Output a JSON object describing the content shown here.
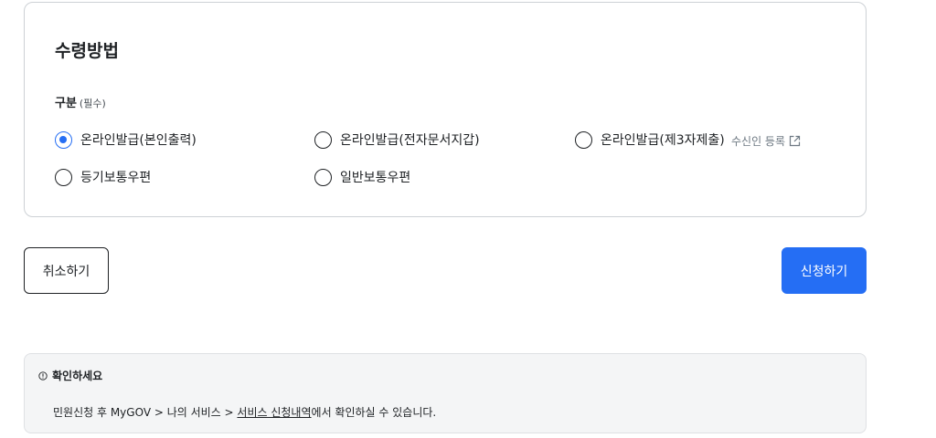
{
  "receipt": {
    "title": "수령방법",
    "field_label": "구분",
    "field_required": "(필수)",
    "options": [
      {
        "label": "온라인발급(본인출력)",
        "checked": true
      },
      {
        "label": "온라인발급(전자문서지갑)",
        "checked": false
      },
      {
        "label": "온라인발급(제3자제출)",
        "checked": false
      },
      {
        "label": "등기보통우편",
        "checked": false
      },
      {
        "label": "일반보통우편",
        "checked": false
      }
    ],
    "recipient_link": "수신인 등록",
    "recipient_link_icon": "external-link-icon"
  },
  "actions": {
    "cancel_label": "취소하기",
    "submit_label": "신청하기"
  },
  "notice": {
    "icon": "info-circle-icon",
    "title": "확인하세요",
    "text_before": "민원신청 후 MyGOV > 나의 서비스 > ",
    "link_text": "서비스 신청내역",
    "text_after": "에서 확인하실 수 있습니다."
  },
  "colors": {
    "accent": "#256ef4",
    "text": "#1e2124",
    "muted": "#6d7882",
    "notice_bg": "#f4f5f6",
    "border": "#cdd1d5"
  }
}
